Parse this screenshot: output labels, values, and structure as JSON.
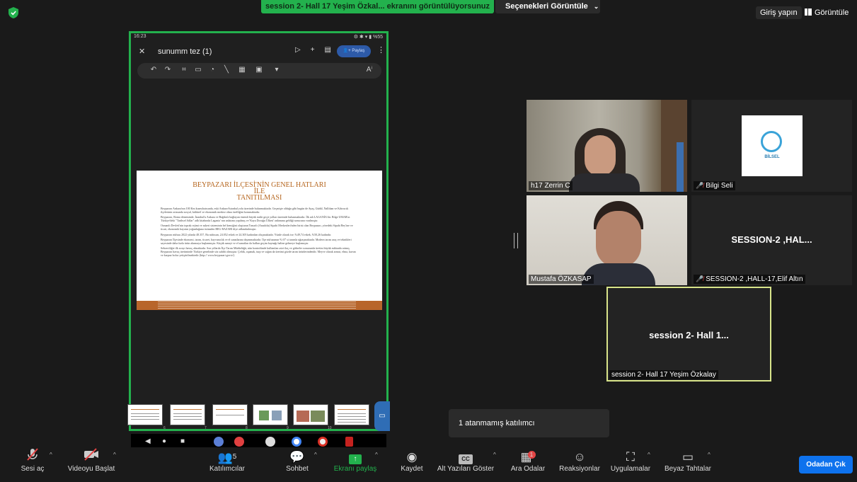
{
  "top": {
    "sharing_banner": "session 2- Hall 17 Yeşim Özkal... ekranını görüntülüyorsunuz",
    "view_options": "Seçenekleri Görüntüle",
    "signin": "Giriş yapın",
    "view": "Görüntüle"
  },
  "shared_screen": {
    "status_time": "16:23",
    "status_right": "⚙ ✱ ▾ ▮ %55",
    "doc_title": "sunumm tez (1)",
    "share_label": "Paylaş",
    "slide": {
      "title_line1": "BEYPAZARI İLÇESİ'NİN GENEL HATLARI",
      "title_line2": "İLE",
      "title_line3": "TANITILMASI",
      "paragraphs": [
        "Beypazarı Ankara'nın 100 Km kuzeybatısında, eski Ankara-İstanbul yolu üzerinde bulunmaktadır. Geçmişte olduğu gibi bugün de Ayaş, Güdül, Nallıhan ve Kıbrıscık ilçelerinin ortasında sosyal, kültürel ve ekonomik merkez olma özelliğini korumaktadır.",
        "Beypazarı, Roma döneminde, İstanbul'u Ankara ve Bağdat'a bağlayan önemli büyük tarihi geçit yolları üzerinde bulunmaktadır. İlk adı LAGANİA'dır. Bilge UMAR'ın Türkiye'deki \"Tarihsel Adlar\" adlı kitabında Lagania' nın anlatımı yapılmış ve 'Kaya Doruğu Ülkesi' anlamına geldiği sonucuna varılmıştır.",
        "Osmanlı Devleti'nin toprak rejimi ve askeri sisteminin bel kemiğini oluşturan Tımarlı (Anadolu) Sipahi Merkezleri'nden birisi olan Beypazarı, yöredeki Sipahi Bey'ine ve ticari, ekonomik hayatın yoğunluğuna istinaden BEG BAZARI diye adlandırılmıştır.",
        "Beypazarı nüfusu 2022 yılında 48.357, Bu nüfusun, 24.052 erkek ve 24.305 kadından oluşmaktadır. Yüzde olarak ise; %49,74 erkek, %50,26 kadındır.",
        "Beypazarı İlçesinde ekonomi, tarım, ticaret, hayvancılık ve el sanatlarına dayanmaktadır. İlçe nüfusunun % 67' si tarımla uğraşmaktadır. Modern tarım araç ve teknikleri sayesinde daha fazla ürün alınmaya başlanmıştır. Küçük sanayi ve el sanatları da halkın geçim kaynağı haline gelmeye başlamıştır.",
        "Sebzeciliğte ilk sırayı havuç almaktadır. Son yıllarda İlçe Tarım Müdürlüğü, nün kontrolünde kullanılan ızizi ilaç ve gübreler sonucunda üretim büyük miktarda artmış Beypazarı havuç üretiminde Türkiye genelinde söz sahibi olmuştur. Çeltik, ıspanak, turp ve soğan da üretimi gözde tarım ürünlerindendir. Meyve olarak armut, elma, kavun ve karpuz bolca yetiştirilmektedir (http:// www.beypazari.gov.tr/)"
      ]
    },
    "thumb_numbers": [
      "6",
      "7",
      "8",
      "9",
      "10"
    ]
  },
  "participants": [
    {
      "name": "h17 Zerrin C",
      "muted": false
    },
    {
      "name": "Bilgi Seli",
      "muted": true
    },
    {
      "name": "Mustafa ÖZKASAP",
      "muted": false
    },
    {
      "name": "SESSION-2 ,HALL-17,Elif Altın",
      "display": "SESSION-2 ,HAL...",
      "muted": true
    },
    {
      "name": "session 2- Hall 17 Yeşim Özkalay",
      "display": "session 2- Hall 1...",
      "muted": false
    }
  ],
  "bilgi_logo_text": "BİLSEL",
  "popup": "1 atanmamış katılımcı",
  "toolbar": {
    "unmute": "Sesi aç",
    "start_video": "Videoyu Başlat",
    "participants": "Katılımcılar",
    "participant_count": "5",
    "chat": "Sohbet",
    "share": "Ekranı paylaş",
    "record": "Kaydet",
    "captions": "Alt Yazıları Göster",
    "breakout": "Ara Odalar",
    "breakout_badge": "1",
    "reactions": "Reaksiyonlar",
    "apps": "Uygulamalar",
    "whiteboard": "Beyaz Tahtalar",
    "leave": "Odadan Çık"
  },
  "colors": {
    "share_green": "#23b14d",
    "active_speaker": "#d8e48a",
    "leave_blue": "#0e72ed",
    "slide_title": "#b5651d"
  }
}
